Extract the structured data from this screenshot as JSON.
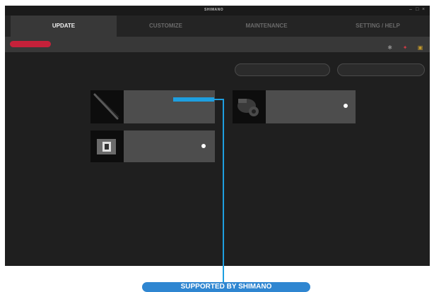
{
  "titlebar": {
    "app_name": "",
    "brand": "SHIMANO",
    "controls": {
      "minimize": "–",
      "maximize": "□",
      "close": "×"
    }
  },
  "tabs": [
    {
      "label": "UPDATE",
      "active": true
    },
    {
      "label": "CUSTOMIZE",
      "active": false
    },
    {
      "label": "MAINTENANCE",
      "active": false
    },
    {
      "label": "SETTING / HELP",
      "active": false
    }
  ],
  "subbar": {
    "mode_pill": "",
    "mode_label": "",
    "icons": [
      "bluetooth-icon",
      "settings-icon",
      "menu-icon"
    ]
  },
  "buttons": {
    "left": "",
    "right": ""
  },
  "cards": [
    {
      "category": "",
      "model": "",
      "version": "",
      "thumb": "cable-icon",
      "supported_tag": ""
    },
    {
      "category": "",
      "model": "",
      "version": "",
      "thumb": "derailleur-icon"
    },
    {
      "category": "",
      "model": "",
      "version": "",
      "thumb": "battery-icon"
    }
  ],
  "annotation": {
    "banner": "SUPPORTED BY SHIMANO"
  },
  "colors": {
    "accent_red": "#c5213a",
    "callout_blue": "#1e9fe0",
    "banner_blue": "#2f86d1"
  }
}
